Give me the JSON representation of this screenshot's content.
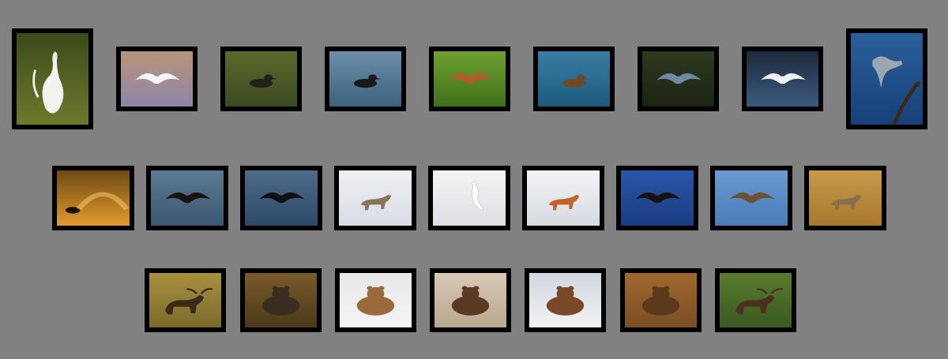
{
  "gallery": {
    "rows": [
      {
        "items": [
          {
            "subject": "great-egret-in-grass",
            "bg": [
              "#3c4a1c",
              "#6d7a2c"
            ],
            "figure": "#f2f2f0",
            "shape": "egret"
          },
          {
            "subject": "egret-in-flight",
            "bg": [
              "#b8937a",
              "#8f86a6"
            ],
            "figure": "#f5f5f5",
            "shape": "bird-fly"
          },
          {
            "subject": "ducks-on-water",
            "bg": [
              "#5a6a2c",
              "#3c4a22"
            ],
            "figure": "#20201c",
            "shape": "duck"
          },
          {
            "subject": "loon-on-lake",
            "bg": [
              "#6c8ea8",
              "#3d627e"
            ],
            "figure": "#1a1a1a",
            "shape": "duck"
          },
          {
            "subject": "bluebird-wings-spread",
            "bg": [
              "#6ea031",
              "#3f7019"
            ],
            "figure": "#b35a2a",
            "shape": "bird-fly"
          },
          {
            "subject": "duck-with-duckling",
            "bg": [
              "#3a7ea3",
              "#1d5a80"
            ],
            "figure": "#6b4a25",
            "shape": "duck"
          },
          {
            "subject": "heron-fishing",
            "bg": [
              "#2d3a1e",
              "#1a2412"
            ],
            "figure": "#6f8aa2",
            "shape": "bird-fly"
          },
          {
            "subject": "egret-landing-reflection",
            "bg": [
              "#1d2a3a",
              "#3a5a7e"
            ],
            "figure": "#f0f0f0",
            "shape": "bird-fly"
          },
          {
            "subject": "heron-on-branch",
            "bg": [
              "#2a5f9a",
              "#174079"
            ],
            "figure": "#9aa6b0",
            "shape": "heron"
          }
        ]
      },
      {
        "items": [
          {
            "subject": "bison-in-steam",
            "bg": [
              "#6d4a14",
              "#e39a2e"
            ],
            "figure": "#1a1208",
            "shape": "bison"
          },
          {
            "subject": "eagle-over-water",
            "bg": [
              "#5d7b93",
              "#3b5670"
            ],
            "figure": "#1a1410",
            "shape": "bird-fly"
          },
          {
            "subject": "eagle-grabbing-fish",
            "bg": [
              "#4e6c8a",
              "#2c4a68"
            ],
            "figure": "#101010",
            "shape": "bird-fly"
          },
          {
            "subject": "coyote-in-snow",
            "bg": [
              "#eef0f4",
              "#d8dce4"
            ],
            "figure": "#8a7458",
            "shape": "canine"
          },
          {
            "subject": "ermine-in-snow",
            "bg": [
              "#f4f4f6",
              "#dcdfe4"
            ],
            "figure": "#ffffff",
            "shape": "ermine"
          },
          {
            "subject": "fox-in-snow",
            "bg": [
              "#f2f3f6",
              "#d6dae1"
            ],
            "figure": "#c0642a",
            "shape": "canine"
          },
          {
            "subject": "eagle-landing-on-branch",
            "bg": [
              "#2a56a8",
              "#1a3c80"
            ],
            "figure": "#151210",
            "shape": "bird-fly"
          },
          {
            "subject": "osprey-in-flight",
            "bg": [
              "#6a9ad0",
              "#4a7cb8"
            ],
            "figure": "#6a5035",
            "shape": "bird-fly"
          },
          {
            "subject": "coyote-pouncing",
            "bg": [
              "#c89a4a",
              "#a8782e"
            ],
            "figure": "#8a6e4a",
            "shape": "canine"
          }
        ]
      },
      {
        "items": [
          {
            "subject": "moose-sparring",
            "bg": [
              "#a89040",
              "#7a6a2a"
            ],
            "figure": "#3a2a1a",
            "shape": "moose"
          },
          {
            "subject": "bear-cubs-embracing",
            "bg": [
              "#7a5a2a",
              "#4a3a1a"
            ],
            "figure": "#3a2e22",
            "shape": "bear"
          },
          {
            "subject": "bear-with-salmon",
            "bg": [
              "#e8e8ea",
              "#f4f4f6"
            ],
            "figure": "#9a6a3a",
            "shape": "bear"
          },
          {
            "subject": "bear-family",
            "bg": [
              "#d8c8b4",
              "#b8a890"
            ],
            "figure": "#5a3a22",
            "shape": "bear"
          },
          {
            "subject": "bears-in-waterfall",
            "bg": [
              "#d0d6de",
              "#f2f4f6"
            ],
            "figure": "#7a4a28",
            "shape": "bear"
          },
          {
            "subject": "bears-face-closeup",
            "bg": [
              "#a06830",
              "#7a4e22"
            ],
            "figure": "#5a3a1a",
            "shape": "bear"
          },
          {
            "subject": "moose-in-water",
            "bg": [
              "#5a7a30",
              "#3a5a20"
            ],
            "figure": "#4a3220",
            "shape": "moose"
          }
        ]
      }
    ]
  }
}
